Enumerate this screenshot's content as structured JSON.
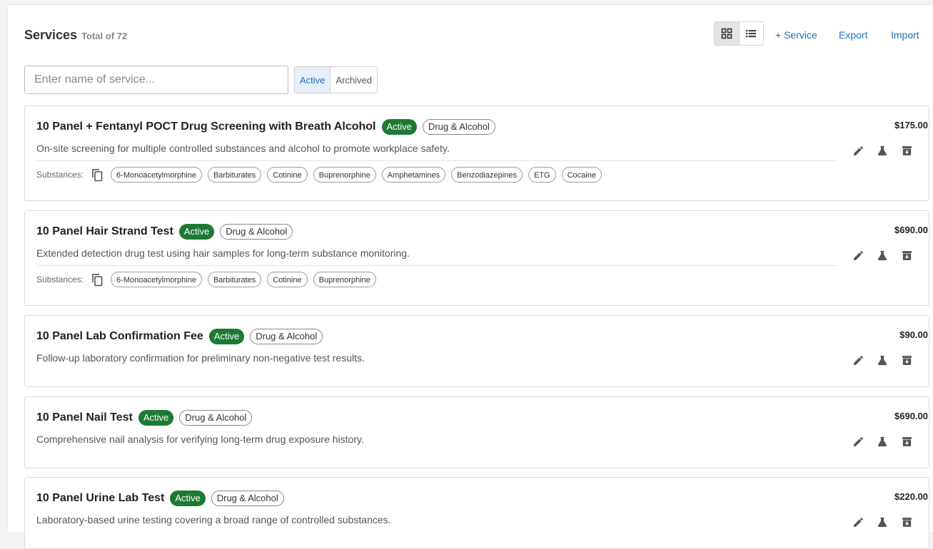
{
  "header": {
    "title": "Services",
    "total": "Total of 72",
    "add_label": "+ Service",
    "export_label": "Export",
    "import_label": "Import"
  },
  "search": {
    "placeholder": "Enter name of service...",
    "value": ""
  },
  "status_filter": {
    "active_label": "Active",
    "archived_label": "Archived",
    "selected": "Active"
  },
  "substances_label": "Substances:",
  "services": [
    {
      "name": "10 Panel + Fentanyl POCT Drug Screening with Breath Alcohol",
      "status": "Active",
      "category": "Drug & Alcohol",
      "description": "On-site screening for multiple controlled substances and alcohol to promote workplace safety.",
      "price": "$175.00",
      "substances": [
        "6-Monoacetylmorphine",
        "Barbiturates",
        "Cotinine",
        "Buprenorphine",
        "Amphetamines",
        "Benzodiazepines",
        "ETG",
        "Cocaine"
      ]
    },
    {
      "name": "10 Panel Hair Strand Test",
      "status": "Active",
      "category": "Drug & Alcohol",
      "description": "Extended detection drug test using hair samples for long-term substance monitoring.",
      "price": "$690.00",
      "substances": [
        "6-Monoacetylmorphine",
        "Barbiturates",
        "Cotinine",
        "Buprenorphine"
      ]
    },
    {
      "name": "10 Panel Lab Confirmation Fee",
      "status": "Active",
      "category": "Drug & Alcohol",
      "description": "Follow-up laboratory confirmation for preliminary non-negative test results.",
      "price": "$90.00",
      "substances": []
    },
    {
      "name": "10 Panel Nail Test",
      "status": "Active",
      "category": "Drug & Alcohol",
      "description": "Comprehensive nail analysis for verifying long-term drug exposure history.",
      "price": "$690.00",
      "substances": []
    },
    {
      "name": "10 Panel Urine Lab Test",
      "status": "Active",
      "category": "Drug & Alcohol",
      "description": "Laboratory-based urine testing covering a broad range of controlled substances.",
      "price": "$220.00",
      "substances": []
    }
  ],
  "colors": {
    "accent": "#1e6fc0",
    "active_badge": "#1d7a33"
  }
}
